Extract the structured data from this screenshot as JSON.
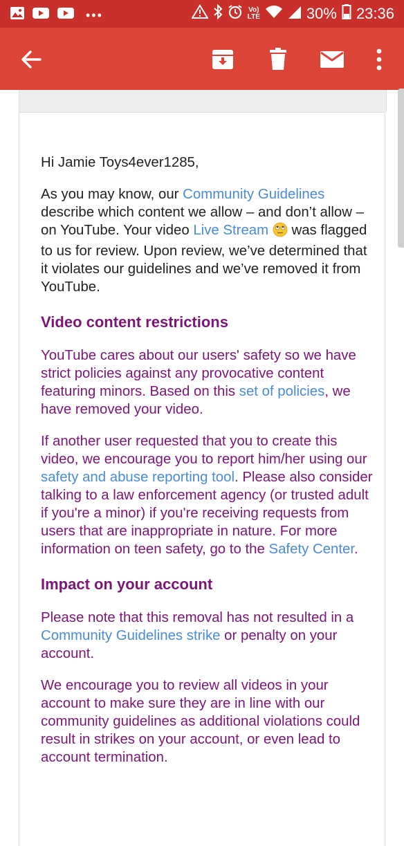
{
  "status_bar": {
    "battery_percent": "30%",
    "time": "23:36",
    "volte_label": "Vo)",
    "lte_label": "LTE",
    "left_icons": [
      "gallery-icon",
      "youtube-icon",
      "youtube-icon",
      "more-notifications-dots"
    ],
    "right_icons": [
      "warning-icon",
      "bluetooth-icon",
      "alarm-icon",
      "volte-lte-icon",
      "wifi-icon",
      "signal-icon",
      "battery-icon"
    ]
  },
  "toolbar": {
    "icons": [
      "back-arrow-icon",
      "archive-icon",
      "delete-icon",
      "mark-unread-icon",
      "overflow-menu-icon"
    ],
    "color": "#db4437",
    "status_color": "#c9302c"
  },
  "email": {
    "greeting": "Hi Jamie Toys4ever1285,",
    "intro": {
      "t1": "As you may know, our ",
      "link_guidelines": "Community Guidelines",
      "t2": " describe which content we allow – and don’t allow – on YouTube. Your video ",
      "link_video": "Live Stream",
      "emoji": "eye-roll-emoji",
      "t3": " was flagged to us for review. Upon review, we’ve determined that it violates our guidelines and we’ve removed it from YouTube."
    },
    "section1": {
      "heading": "Video content restrictions",
      "p1": {
        "t1": "YouTube cares about our users' safety so we have strict policies against any provocative content featuring minors. Based on this ",
        "link": "set of policies",
        "t2": ", we have removed your video."
      },
      "p2": {
        "t1": "If another user requested that you to create this video, we encourage you to report him/her using our ",
        "link1": "safety and abuse reporting tool",
        "t2": ". Please also consider talking to a law enforcement agency (or trusted adult if you're a minor) if you're receiving requests from users that are inappropriate in nature. For more information on teen safety, go to the ",
        "link2": "Safety Center",
        "t3": "."
      }
    },
    "section2": {
      "heading": "Impact on your account",
      "p1": {
        "t1": "Please note that this removal has not resulted in a ",
        "link": "Community Guidelines strike",
        "t2": " or penalty on your account."
      },
      "p2": "We encourage you to review all videos in your account to make sure they are in line with our community guidelines as additional violations could result in strikes on your account, or even lead to account termination."
    },
    "colors": {
      "text": "#212121",
      "purple_text": "#7b1675",
      "link": "#4a8ad8"
    }
  }
}
